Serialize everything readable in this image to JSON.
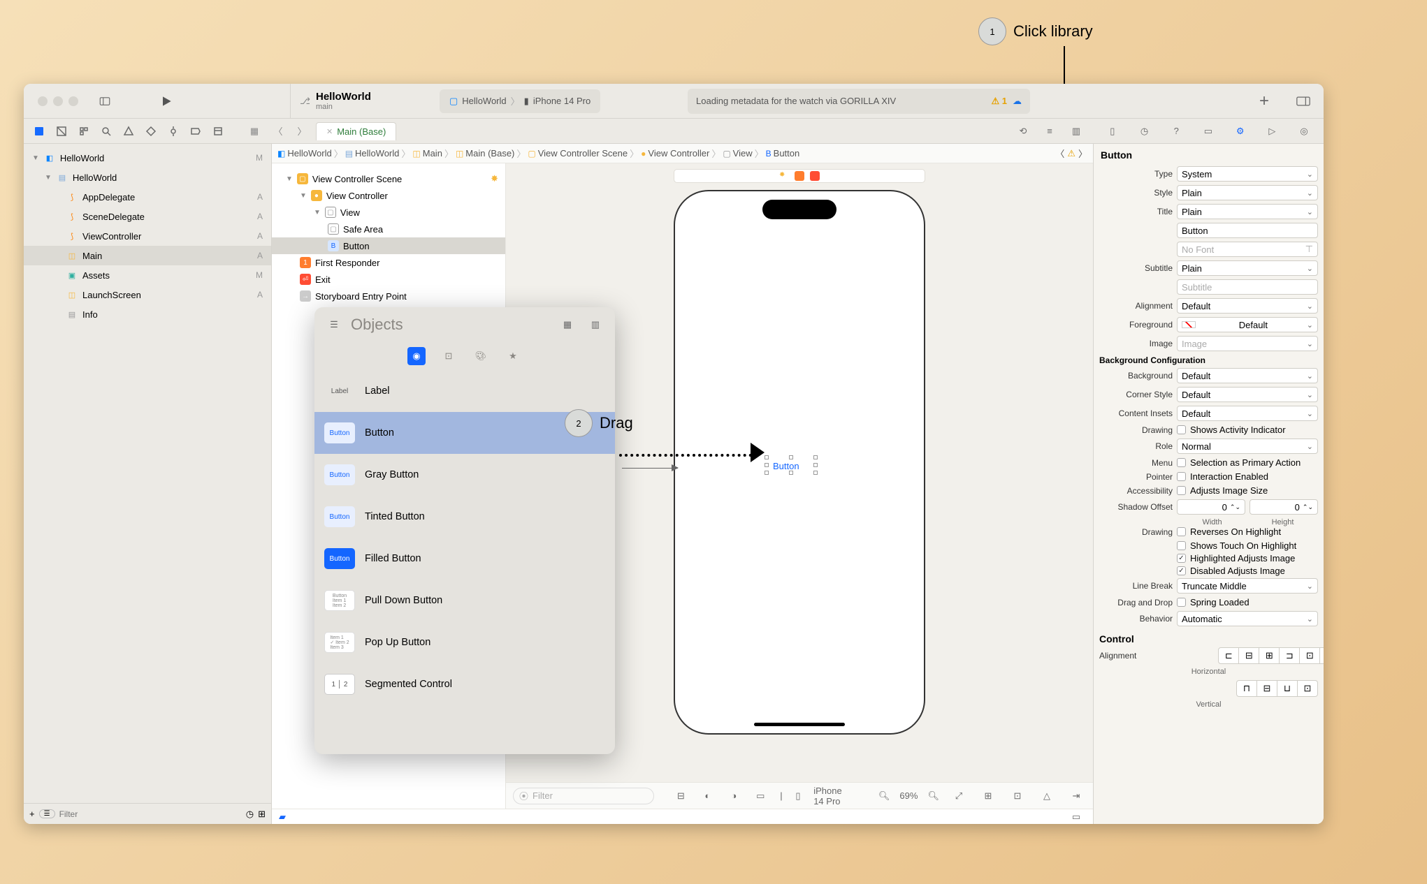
{
  "callouts": {
    "one": {
      "number": "1",
      "text": "Click library"
    },
    "two": {
      "number": "2",
      "text": "Drag"
    }
  },
  "window": {
    "project_name": "HelloWorld",
    "branch": "main",
    "dest_app": "HelloWorld",
    "dest_device": "iPhone 14 Pro",
    "status_text": "Loading metadata for the watch via GORILLA XIV",
    "warn_count": "1",
    "tab_label": "Main (Base)"
  },
  "navigator": {
    "items": [
      {
        "name": "HelloWorld",
        "kind": "project",
        "badge": "M",
        "level": 0,
        "disc": true
      },
      {
        "name": "HelloWorld",
        "kind": "folder",
        "badge": "",
        "level": 1,
        "disc": true
      },
      {
        "name": "AppDelegate",
        "kind": "swift",
        "badge": "A",
        "level": 2
      },
      {
        "name": "SceneDelegate",
        "kind": "swift",
        "badge": "A",
        "level": 2
      },
      {
        "name": "ViewController",
        "kind": "swift",
        "badge": "A",
        "level": 2
      },
      {
        "name": "Main",
        "kind": "sb",
        "badge": "A",
        "level": 2,
        "sel": true
      },
      {
        "name": "Assets",
        "kind": "assets",
        "badge": "M",
        "level": 2
      },
      {
        "name": "LaunchScreen",
        "kind": "sb",
        "badge": "A",
        "level": 2
      },
      {
        "name": "Info",
        "kind": "plist",
        "badge": "",
        "level": 2
      }
    ],
    "filter_placeholder": "Filter"
  },
  "jumpbar": [
    "HelloWorld",
    "HelloWorld",
    "Main",
    "Main (Base)",
    "View Controller Scene",
    "View Controller",
    "View",
    "Button"
  ],
  "outline": [
    {
      "name": "View Controller Scene",
      "kind": "scene",
      "level": 1,
      "disc": true,
      "star": true
    },
    {
      "name": "View Controller",
      "kind": "vc",
      "level": 2,
      "disc": true
    },
    {
      "name": "View",
      "kind": "view",
      "level": 3,
      "disc": true
    },
    {
      "name": "Safe Area",
      "kind": "view",
      "level": 4
    },
    {
      "name": "Button",
      "kind": "btn",
      "level": 4,
      "sel": true
    },
    {
      "name": "First Responder",
      "kind": "fr",
      "level": 2
    },
    {
      "name": "Exit",
      "kind": "exit",
      "level": 2
    },
    {
      "name": "Storyboard Entry Point",
      "kind": "ep",
      "level": 2
    }
  ],
  "canvas": {
    "button_text": "Button",
    "device_label": "iPhone 14 Pro",
    "zoom": "69%",
    "filter_placeholder": "Filter"
  },
  "library": {
    "title": "Objects",
    "items": [
      {
        "label": "Label",
        "thumb": "Label"
      },
      {
        "label": "Button",
        "thumb": "Button",
        "sel": true
      },
      {
        "label": "Gray Button",
        "thumb": "Button"
      },
      {
        "label": "Tinted Button",
        "thumb": "Button"
      },
      {
        "label": "Filled Button",
        "thumb": "Button"
      },
      {
        "label": "Pull Down Button",
        "thumb": "menu"
      },
      {
        "label": "Pop Up Button",
        "thumb": "menu"
      },
      {
        "label": "Segmented Control",
        "thumb": "seg"
      }
    ]
  },
  "inspector": {
    "title": "Button",
    "type": "System",
    "style": "Plain",
    "title_style": "Plain",
    "title_text": "Button",
    "font_placeholder": "No Font",
    "subtitle_style": "Plain",
    "subtitle_placeholder": "Subtitle",
    "alignment": "Default",
    "foreground": "Default",
    "image_placeholder": "Image",
    "bg_section": "Background Configuration",
    "background": "Default",
    "corner_style": "Default",
    "content_insets": "Default",
    "drawing_chk1": "Shows Activity Indicator",
    "role": "Normal",
    "menu_chk": "Selection as Primary Action",
    "pointer_chk": "Interaction Enabled",
    "a11y_chk": "Adjusts Image Size",
    "shadow_label": "Shadow Offset",
    "shadow_w": "0",
    "shadow_h": "0",
    "w_label": "Width",
    "h_label": "Height",
    "drawing2_1": "Reverses On Highlight",
    "drawing2_2": "Shows Touch On Highlight",
    "drawing2_3": "Highlighted Adjusts Image",
    "drawing2_4": "Disabled Adjusts Image",
    "line_break": "Truncate Middle",
    "dnd_chk": "Spring Loaded",
    "behavior": "Automatic",
    "control_section": "Control",
    "horiz_label": "Horizontal",
    "vert_label": "Vertical",
    "labels": {
      "type": "Type",
      "style": "Style",
      "title": "Title",
      "subtitle": "Subtitle",
      "alignment": "Alignment",
      "foreground": "Foreground",
      "image": "Image",
      "background": "Background",
      "corner": "Corner Style",
      "insets": "Content Insets",
      "drawing": "Drawing",
      "role": "Role",
      "menu": "Menu",
      "pointer": "Pointer",
      "a11y": "Accessibility",
      "linebreak": "Line Break",
      "dnd": "Drag and Drop",
      "behavior": "Behavior",
      "ctrl_align": "Alignment"
    }
  }
}
